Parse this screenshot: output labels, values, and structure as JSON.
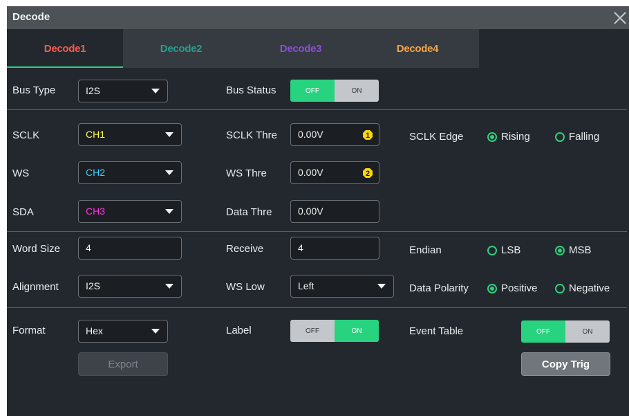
{
  "window": {
    "title": "Decode"
  },
  "tabs": [
    {
      "label": "Decode1",
      "color": "#ff5a4e",
      "active": true
    },
    {
      "label": "Decode2",
      "color": "#2a9c92",
      "active": false
    },
    {
      "label": "Decode3",
      "color": "#8b4fd8",
      "active": false
    },
    {
      "label": "Decode4",
      "color": "#f5a44a",
      "active": false
    }
  ],
  "bus": {
    "type_label": "Bus Type",
    "type_value": "I2S",
    "status_label": "Bus Status",
    "status_off": "OFF",
    "status_on": "ON",
    "status_state": "OFF"
  },
  "sclk": {
    "label": "SCLK",
    "channel": "CH1",
    "channel_color": "#ffff3c",
    "thre_label": "SCLK Thre",
    "thre_value": "0.00V",
    "thre_badge": "1",
    "edge_label": "SCLK Edge",
    "edge_options": [
      "Rising",
      "Falling"
    ],
    "edge_selected": "Rising"
  },
  "ws": {
    "label": "WS",
    "channel": "CH2",
    "channel_color": "#3cd0ff",
    "thre_label": "WS Thre",
    "thre_value": "0.00V",
    "thre_badge": "2"
  },
  "sda": {
    "label": "SDA",
    "channel": "CH3",
    "channel_color": "#ff33dd",
    "thre_label": "Data Thre",
    "thre_value": "0.00V"
  },
  "word": {
    "size_label": "Word Size",
    "size_value": "4",
    "receive_label": "Receive",
    "receive_value": "4",
    "endian_label": "Endian",
    "endian_options": [
      "LSB",
      "MSB"
    ],
    "endian_selected": "MSB"
  },
  "align": {
    "label": "Alignment",
    "value": "I2S",
    "ws_low_label": "WS Low",
    "ws_low_value": "Left",
    "polarity_label": "Data Polarity",
    "polarity_options": [
      "Positive",
      "Negative"
    ],
    "polarity_selected": "Positive"
  },
  "format": {
    "label": "Format",
    "value": "Hex"
  },
  "label_toggle": {
    "label": "Label",
    "off": "OFF",
    "on": "ON",
    "state": "ON"
  },
  "event_table": {
    "label": "Event Table",
    "off": "OFF",
    "on": "ON",
    "state": "OFF"
  },
  "buttons": {
    "export": "Export",
    "copy_trig": "Copy Trig"
  },
  "colors": {
    "accent_green": "#27d37e",
    "badge_yellow": "#ffd700"
  }
}
